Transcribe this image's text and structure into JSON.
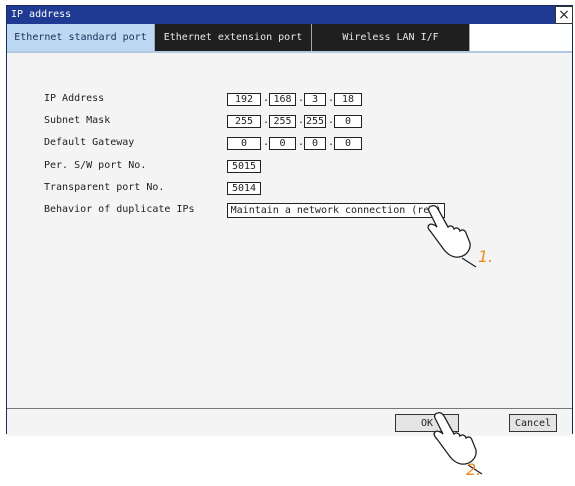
{
  "window": {
    "title": "IP address",
    "close_glyph": "×"
  },
  "tabs": [
    {
      "label": "Ethernet standard port",
      "active": true
    },
    {
      "label": "Ethernet extension port",
      "active": false
    },
    {
      "label": "Wireless LAN I/F",
      "active": false
    }
  ],
  "form": {
    "ip_address": {
      "label": "IP Address",
      "octets": [
        "192",
        "168",
        "3",
        "18"
      ]
    },
    "subnet_mask": {
      "label": "Subnet Mask",
      "octets": [
        "255",
        "255",
        "255",
        "0"
      ]
    },
    "default_gateway": {
      "label": "Default Gateway",
      "octets": [
        "0",
        "0",
        "0",
        "0"
      ]
    },
    "sw_port": {
      "label": "Per. S/W port No.",
      "value": "5015"
    },
    "transparent_port": {
      "label": "Transparent port No.",
      "value": "5014"
    },
    "duplicate_ip": {
      "label": "Behavior of duplicate IPs",
      "value": "Maintain a network connection (rec)"
    },
    "separator": "."
  },
  "footer": {
    "ok_label": "OK",
    "cancel_label": "Cancel"
  },
  "annotations": {
    "step1": "1.",
    "step2": "2."
  },
  "colors": {
    "title_bar": "#1f3a93",
    "active_tab": "#bcd8f2",
    "inactive_tab": "#1f1f1f",
    "step_number": "#ef8a1f"
  }
}
